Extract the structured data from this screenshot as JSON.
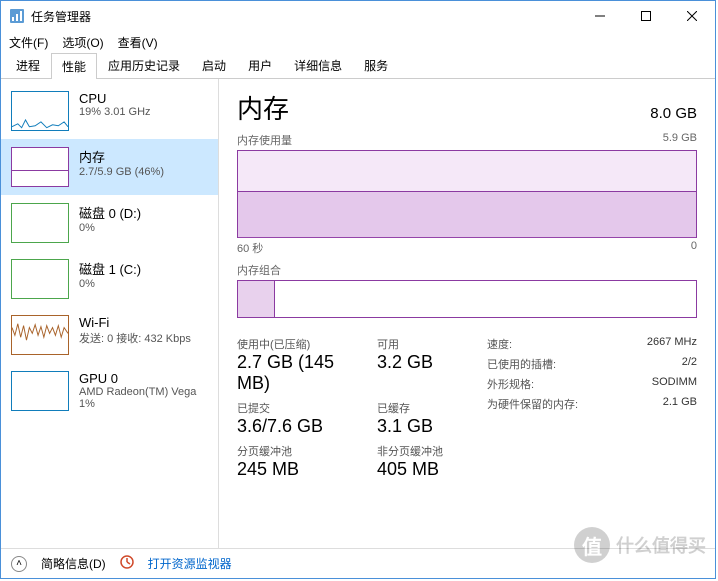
{
  "window": {
    "title": "任务管理器"
  },
  "menu": {
    "file": "文件(F)",
    "options": "选项(O)",
    "view": "查看(V)"
  },
  "tabs": [
    "进程",
    "性能",
    "应用历史记录",
    "启动",
    "用户",
    "详细信息",
    "服务"
  ],
  "active_tab": 1,
  "sidebar": [
    {
      "title": "CPU",
      "sub": "19% 3.01 GHz",
      "kind": "cpu"
    },
    {
      "title": "内存",
      "sub": "2.7/5.9 GB (46%)",
      "kind": "mem",
      "selected": true
    },
    {
      "title": "磁盘 0 (D:)",
      "sub": "0%",
      "kind": "disk"
    },
    {
      "title": "磁盘 1 (C:)",
      "sub": "0%",
      "kind": "disk"
    },
    {
      "title": "Wi-Fi",
      "sub": "发送: 0 接收: 432 Kbps",
      "kind": "wifi"
    },
    {
      "title": "GPU 0",
      "sub": "AMD Radeon(TM) Vega",
      "sub2": "1%",
      "kind": "gpu"
    }
  ],
  "main": {
    "title": "内存",
    "total": "8.0 GB",
    "usage_label": "内存使用量",
    "usage_max": "5.9 GB",
    "x_left": "60 秒",
    "x_right": "0",
    "composition_label": "内存组合",
    "stats": {
      "in_use_label": "使用中(已压缩)",
      "in_use_value": "2.7 GB (145 MB)",
      "available_label": "可用",
      "available_value": "3.2 GB",
      "committed_label": "已提交",
      "committed_value": "3.6/7.6 GB",
      "cached_label": "已缓存",
      "cached_value": "3.1 GB",
      "paged_label": "分页缓冲池",
      "paged_value": "245 MB",
      "nonpaged_label": "非分页缓冲池",
      "nonpaged_value": "405 MB"
    },
    "details": {
      "speed_k": "速度:",
      "speed_v": "2667 MHz",
      "slots_k": "已使用的插槽:",
      "slots_v": "2/2",
      "form_k": "外形规格:",
      "form_v": "SODIMM",
      "reserved_k": "为硬件保留的内存:",
      "reserved_v": "2.1 GB"
    }
  },
  "footer": {
    "fewer": "简略信息(D)",
    "resmon": "打开资源监视器"
  },
  "chart_data": {
    "type": "area",
    "title": "内存使用量",
    "ylabel": "GB",
    "ylim": [
      0,
      5.9
    ],
    "x_seconds": [
      60,
      0
    ],
    "series": [
      {
        "name": "In use",
        "approx_value_gb": 2.7,
        "flat": true
      }
    ],
    "composition": {
      "in_use_gb": 2.7,
      "total_gb": 5.9
    }
  }
}
